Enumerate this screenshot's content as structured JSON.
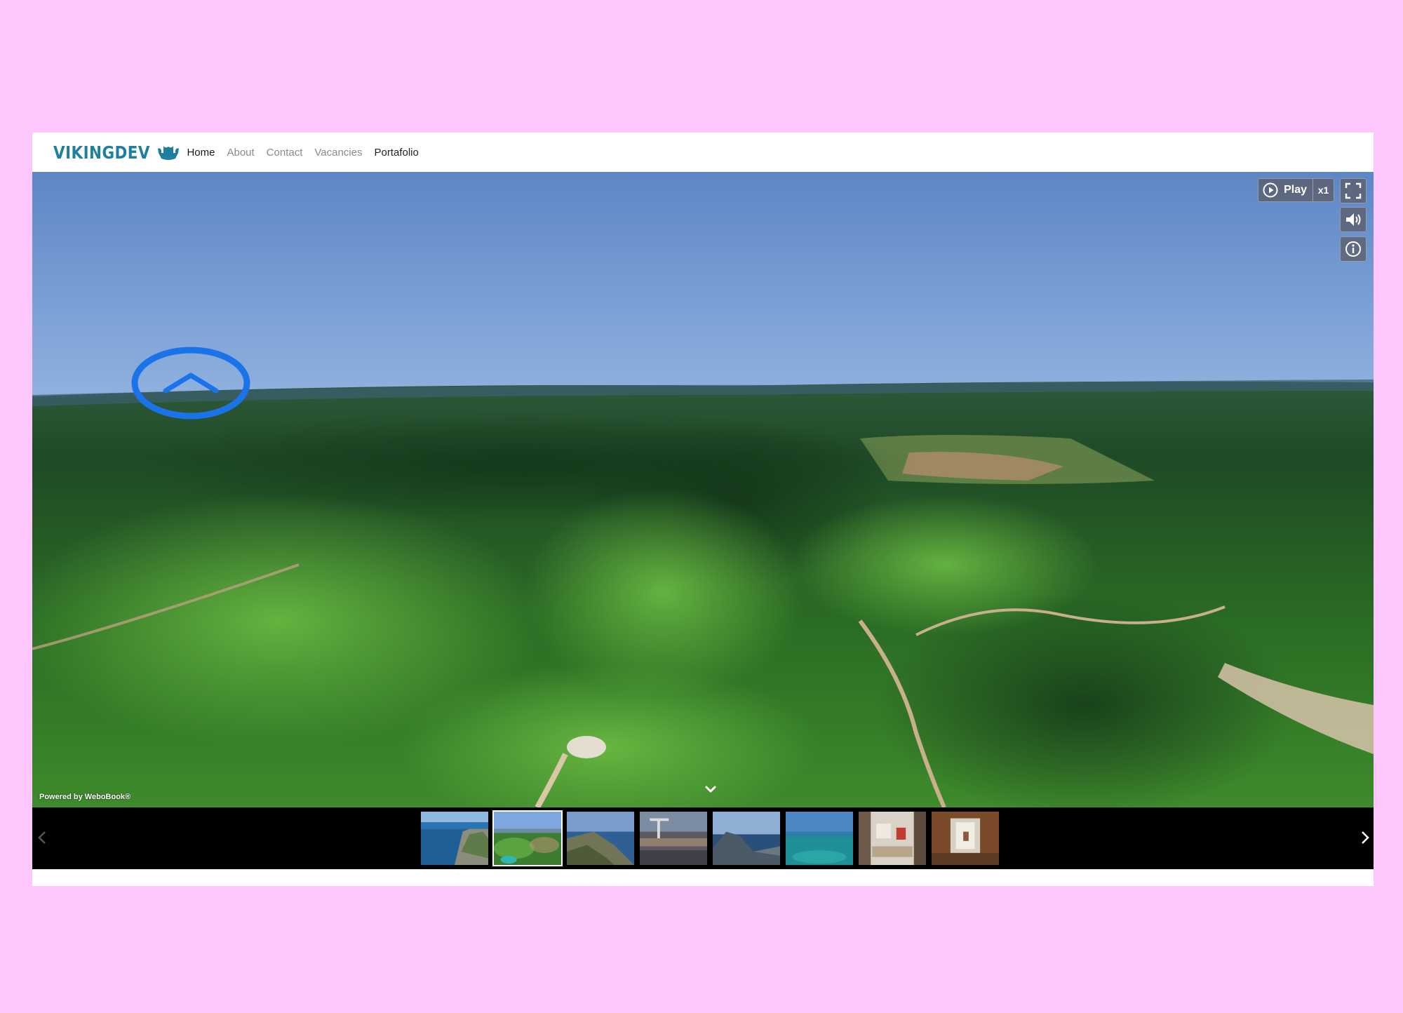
{
  "app": {
    "brand": "VIKINGDEV",
    "logo_icon": "viking-ship-icon",
    "accent_color": "#1f7fa0",
    "page_background": "#fdc6fd"
  },
  "nav": {
    "items": [
      {
        "label": "Home",
        "state": "active"
      },
      {
        "label": "About",
        "state": "normal"
      },
      {
        "label": "Contact",
        "state": "normal"
      },
      {
        "label": "Vacancies",
        "state": "normal"
      },
      {
        "label": "Portafolio",
        "state": "normal"
      }
    ]
  },
  "viewer": {
    "scene": "aerial-forest-panorama",
    "hotspot_icon": "chevron-up-icon",
    "controls": {
      "play_label": "Play",
      "play_icon": "play-circle-icon",
      "speed_label": "x1",
      "fullscreen_icon": "fullscreen-icon",
      "sound_icon": "volume-icon",
      "info_icon": "info-icon"
    },
    "powered_by": "Powered by WeboBook®",
    "collapse_icon": "chevron-down-icon"
  },
  "thumbnail_strip": {
    "prev_icon": "chevron-left-icon",
    "next_icon": "chevron-right-icon",
    "selected_index": 1,
    "items": [
      {
        "scene": "coastal-cliffs"
      },
      {
        "scene": "aerial-forest"
      },
      {
        "scene": "hillside-sea"
      },
      {
        "scene": "harbor-dock"
      },
      {
        "scene": "island-headland"
      },
      {
        "scene": "turquoise-sea"
      },
      {
        "scene": "interior-lobby"
      },
      {
        "scene": "interior-room"
      }
    ]
  }
}
